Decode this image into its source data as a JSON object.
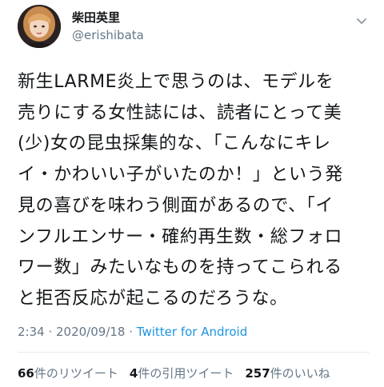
{
  "author": {
    "display_name": "柴田英里",
    "handle": "@erishibata"
  },
  "tweet": {
    "text": "新生LARME炎上で思うのは、モデルを\n売りにする女性誌には、読者にとって美\n(少)女の昆虫採集的な、「こんなにキレ\nイ・かわいい子がいたのか！」という発\n見の喜びを味わう側面があるので、「イ\nンフルエンサー・確約再生数・総フォロ\nワー数」みたいなものを持ってこられる\nと拒否反応が起こるのだろうな。"
  },
  "meta": {
    "time": "2:34",
    "separator1": " · ",
    "date": "2020/09/18",
    "separator2": " · ",
    "source": "Twitter for Android"
  },
  "stats": {
    "retweets_count": "66",
    "retweets_label": "件のリツイート",
    "quotes_count": "4",
    "quotes_label": "件の引用ツイート",
    "likes_count": "257",
    "likes_label": "件のいいね"
  },
  "colors": {
    "text": "#14171a",
    "secondary": "#657786",
    "link": "#1b95e0"
  },
  "icons": {
    "more": "chevron-down-icon"
  }
}
